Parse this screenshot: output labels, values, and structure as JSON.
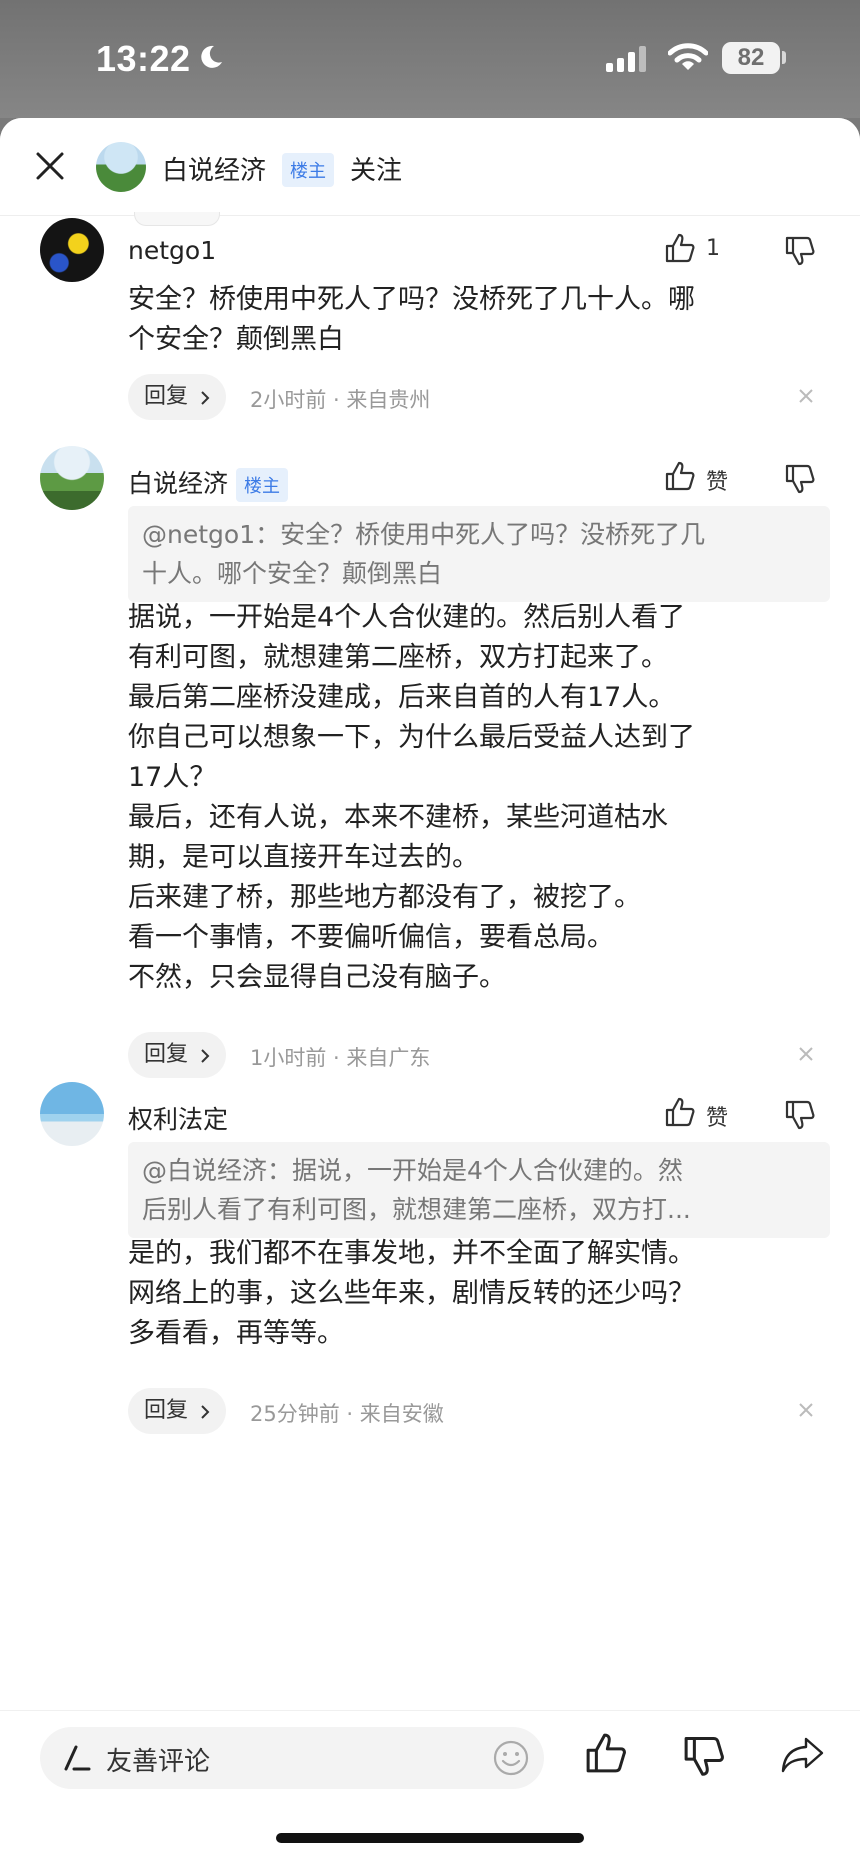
{
  "status_bar": {
    "time": "13:22",
    "battery": "82"
  },
  "header": {
    "author_name": "白说经济",
    "host_badge": "楼主",
    "follow_label": "关注"
  },
  "comments": [
    {
      "username": "netgo1",
      "like_count": "1",
      "body_lines": [
        "安全？桥使用中死人了吗？没桥死了几十人。哪",
        "个安全？颠倒黑白"
      ],
      "reply_label": "回复",
      "meta": "2小时前 · 来自贵州"
    },
    {
      "username": "白说经济",
      "badge": "楼主",
      "like_label": "赞",
      "quote_lines": [
        "@netgo1：安全？桥使用中死人了吗？没桥死了几",
        "十人。哪个安全？颠倒黑白"
      ],
      "body_lines": [
        "据说，一开始是4个人合伙建的。然后别人看了",
        "有利可图，就想建第二座桥，双方打起来了。",
        "最后第二座桥没建成，后来自首的人有17人。",
        "你自己可以想象一下，为什么最后受益人达到了",
        "17人？",
        "最后，还有人说，本来不建桥，某些河道枯水",
        "期，是可以直接开车过去的。",
        "后来建了桥，那些地方都没有了，被挖了。",
        "看一个事情，不要偏听偏信，要看总局。",
        "不然，只会显得自己没有脑子。"
      ],
      "reply_label": "回复",
      "meta": "1小时前 · 来自广东"
    },
    {
      "username": "权利法定",
      "like_label": "赞",
      "quote_lines": [
        "@白说经济：据说，一开始是4个人合伙建的。然",
        "后别人看了有利可图，就想建第二座桥，双方打..."
      ],
      "body_lines": [
        "是的，我们都不在事发地，并不全面了解实情。",
        "网络上的事，这么些年来，剧情反转的还少吗？",
        "多看看，再等等。"
      ],
      "reply_label": "回复",
      "meta": "25分钟前 · 来自安徽"
    }
  ],
  "bottom_bar": {
    "input_placeholder": "友善评论"
  }
}
